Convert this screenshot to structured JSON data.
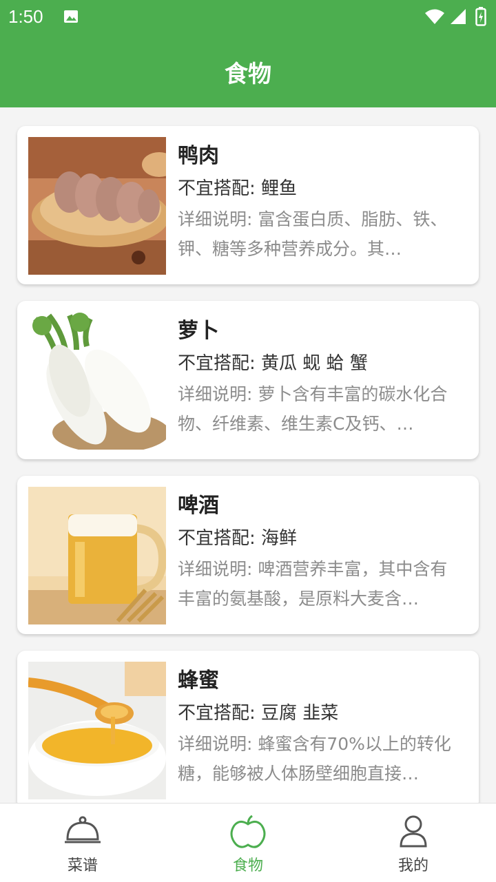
{
  "status_bar": {
    "time": "1:50"
  },
  "app_bar": {
    "title": "食物"
  },
  "foods": [
    {
      "name": "鸭肉",
      "avoid": "不宜搭配: 鲤鱼",
      "desc": "详细说明: 富含蛋白质、脂肪、铁、钾、糖等多种营养成分。其…"
    },
    {
      "name": "萝卜",
      "avoid": "不宜搭配: 黄瓜 蚬 蛤 蟹",
      "desc": "详细说明: 萝卜含有丰富的碳水化合物、纤维素、维生素C及钙、…"
    },
    {
      "name": "啤酒",
      "avoid": "不宜搭配: 海鲜",
      "desc": "详细说明: 啤酒营养丰富，其中含有丰富的氨基酸，是原料大麦含…"
    },
    {
      "name": "蜂蜜",
      "avoid": "不宜搭配: 豆腐 韭菜",
      "desc": "详细说明: 蜂蜜含有70%以上的转化糖，能够被人体肠壁细胞直接…"
    }
  ],
  "bottom_nav": {
    "tabs": [
      {
        "label": "菜谱",
        "icon": "cloche-icon"
      },
      {
        "label": "食物",
        "icon": "apple-icon",
        "active": true
      },
      {
        "label": "我的",
        "icon": "person-icon"
      }
    ]
  },
  "colors": {
    "primary": "#4cae4f",
    "text": "#222222",
    "secondary_text": "#8c8c8c"
  }
}
